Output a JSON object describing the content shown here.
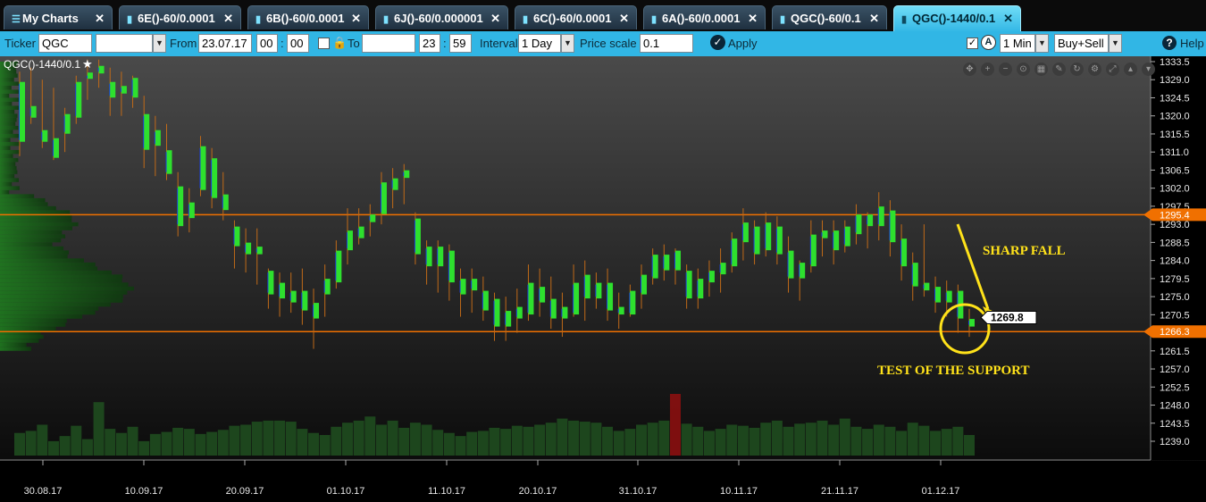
{
  "tabs": [
    {
      "label": "My Charts",
      "icon": "list-icon",
      "active": false
    },
    {
      "label": "6E()-60/0.0001",
      "icon": "bar-chart-icon",
      "active": false
    },
    {
      "label": "6B()-60/0.0001",
      "icon": "bar-chart-icon",
      "active": false
    },
    {
      "label": "6J()-60/0.000001",
      "icon": "bar-chart-icon",
      "active": false
    },
    {
      "label": "6C()-60/0.0001",
      "icon": "bar-chart-icon",
      "active": false
    },
    {
      "label": "6A()-60/0.0001",
      "icon": "bar-chart-icon",
      "active": false
    },
    {
      "label": "QGC()-60/0.1",
      "icon": "bar-chart-icon",
      "active": false
    },
    {
      "label": "QGC()-1440/0.1",
      "icon": "bar-chart-icon",
      "active": true
    }
  ],
  "toolbar": {
    "ticker_label": "Ticker",
    "ticker_value": "QGC",
    "from_label": "From",
    "from_date": "23.07.17",
    "from_hour": "00",
    "from_min": "00",
    "time_sep": ":",
    "to_label": "To",
    "to_hour": "23",
    "to_min": "59",
    "interval_label": "Interval",
    "interval_value": "1 Day",
    "price_scale_label": "Price scale",
    "price_scale_value": "0.1",
    "apply_label": "Apply",
    "timeframe_value": "1 Min",
    "side_value": "Buy+Sell",
    "help_label": "Help"
  },
  "chart": {
    "title": "QGC()-1440/0.1",
    "accent_color": "#f07000",
    "annotation_color": "#ffe21a"
  },
  "chart_data": {
    "type": "candlestick",
    "title": "QGC()-1440/0.1",
    "y_ticks": [
      "1333.5",
      "1329.0",
      "1324.5",
      "1320.0",
      "1315.5",
      "1311.0",
      "1306.5",
      "1302.0",
      "1297.5",
      "1293.0",
      "1288.5",
      "1284.0",
      "1279.5",
      "1275.0",
      "1270.5",
      "1266.0",
      "1261.5",
      "1257.0",
      "1252.5",
      "1248.0",
      "1243.5",
      "1239.0"
    ],
    "ylim": [
      1235.0,
      1335.0
    ],
    "x_ticks": [
      "30.08.17",
      "10.09.17",
      "20.09.17",
      "01.10.17",
      "11.10.17",
      "20.10.17",
      "31.10.17",
      "10.11.17",
      "21.11.17",
      "01.12.17"
    ],
    "horizontal_levels": [
      {
        "value": 1295.4,
        "label": "1295.4",
        "color": "#f07000"
      },
      {
        "value": 1266.3,
        "label": "1266.3",
        "color": "#f07000"
      }
    ],
    "last_price": {
      "value": 1269.8,
      "label": "1269.8"
    },
    "annotations": [
      {
        "text": "SHARP FALL",
        "color": "#ffe21a"
      },
      {
        "text": "TEST OF THE SUPPORT",
        "color": "#ffe21a"
      }
    ],
    "bars": [
      {
        "high": 1331,
        "low": 1310,
        "open": 1328,
        "close": 1314
      },
      {
        "high": 1332,
        "low": 1318,
        "open": 1320,
        "close": 1322
      },
      {
        "high": 1329,
        "low": 1312,
        "open": 1316,
        "close": 1314
      },
      {
        "high": 1327,
        "low": 1309,
        "open": 1310,
        "close": 1314
      },
      {
        "high": 1322,
        "low": 1311,
        "open": 1320,
        "close": 1316
      },
      {
        "high": 1330,
        "low": 1318,
        "open": 1320,
        "close": 1328
      },
      {
        "high": 1334,
        "low": 1324,
        "open": 1330,
        "close": 1330
      },
      {
        "high": 1334,
        "low": 1327,
        "open": 1332,
        "close": 1331
      },
      {
        "high": 1332,
        "low": 1320,
        "open": 1328,
        "close": 1325
      },
      {
        "high": 1331,
        "low": 1320,
        "open": 1326,
        "close": 1327
      },
      {
        "high": 1330,
        "low": 1322,
        "open": 1329,
        "close": 1325
      },
      {
        "high": 1325,
        "low": 1307,
        "open": 1320,
        "close": 1312
      },
      {
        "high": 1320,
        "low": 1305,
        "open": 1316,
        "close": 1313
      },
      {
        "high": 1318,
        "low": 1304,
        "open": 1311,
        "close": 1306
      },
      {
        "high": 1306,
        "low": 1290,
        "open": 1302,
        "close": 1293
      },
      {
        "high": 1302,
        "low": 1291,
        "open": 1298,
        "close": 1295
      },
      {
        "high": 1315,
        "low": 1300,
        "open": 1302,
        "close": 1312
      },
      {
        "high": 1312,
        "low": 1297,
        "open": 1309,
        "close": 1300
      },
      {
        "high": 1306,
        "low": 1294,
        "open": 1300,
        "close": 1297
      },
      {
        "high": 1294,
        "low": 1282,
        "open": 1292,
        "close": 1288
      },
      {
        "high": 1292,
        "low": 1281,
        "open": 1288,
        "close": 1286
      },
      {
        "high": 1292,
        "low": 1278,
        "open": 1286,
        "close": 1287
      },
      {
        "high": 1282,
        "low": 1272,
        "open": 1281,
        "close": 1276
      },
      {
        "high": 1281,
        "low": 1270,
        "open": 1278,
        "close": 1275
      },
      {
        "high": 1281,
        "low": 1271,
        "open": 1276,
        "close": 1274
      },
      {
        "high": 1282,
        "low": 1268,
        "open": 1276,
        "close": 1272
      },
      {
        "high": 1277,
        "low": 1262,
        "open": 1273,
        "close": 1270
      },
      {
        "high": 1283,
        "low": 1270,
        "open": 1276,
        "close": 1279
      },
      {
        "high": 1289,
        "low": 1277,
        "open": 1279,
        "close": 1286
      },
      {
        "high": 1297,
        "low": 1283,
        "open": 1287,
        "close": 1291
      },
      {
        "high": 1297,
        "low": 1288,
        "open": 1290,
        "close": 1292
      },
      {
        "high": 1298,
        "low": 1290,
        "open": 1294,
        "close": 1295
      },
      {
        "high": 1306,
        "low": 1293,
        "open": 1296,
        "close": 1303
      },
      {
        "high": 1307,
        "low": 1297,
        "open": 1302,
        "close": 1304
      },
      {
        "high": 1308,
        "low": 1298,
        "open": 1305,
        "close": 1306
      },
      {
        "high": 1296,
        "low": 1283,
        "open": 1294,
        "close": 1286
      },
      {
        "high": 1289,
        "low": 1278,
        "open": 1287,
        "close": 1283
      },
      {
        "high": 1289,
        "low": 1276,
        "open": 1283,
        "close": 1287
      },
      {
        "high": 1288,
        "low": 1274,
        "open": 1286,
        "close": 1279
      },
      {
        "high": 1282,
        "low": 1270,
        "open": 1279,
        "close": 1276
      },
      {
        "high": 1282,
        "low": 1271,
        "open": 1277,
        "close": 1279
      },
      {
        "high": 1280,
        "low": 1269,
        "open": 1276,
        "close": 1272
      },
      {
        "high": 1276,
        "low": 1264,
        "open": 1274,
        "close": 1268
      },
      {
        "high": 1275,
        "low": 1264,
        "open": 1268,
        "close": 1271
      },
      {
        "high": 1277,
        "low": 1266,
        "open": 1270,
        "close": 1272
      },
      {
        "high": 1283,
        "low": 1269,
        "open": 1271,
        "close": 1278
      },
      {
        "high": 1282,
        "low": 1270,
        "open": 1277,
        "close": 1274
      },
      {
        "high": 1280,
        "low": 1267,
        "open": 1274,
        "close": 1270
      },
      {
        "high": 1276,
        "low": 1265,
        "open": 1270,
        "close": 1272
      },
      {
        "high": 1283,
        "low": 1270,
        "open": 1271,
        "close": 1278
      },
      {
        "high": 1284,
        "low": 1269,
        "open": 1280,
        "close": 1275
      },
      {
        "high": 1281,
        "low": 1272,
        "open": 1275,
        "close": 1278
      },
      {
        "high": 1282,
        "low": 1269,
        "open": 1278,
        "close": 1272
      },
      {
        "high": 1276,
        "low": 1267,
        "open": 1272,
        "close": 1271
      },
      {
        "high": 1278,
        "low": 1270,
        "open": 1271,
        "close": 1276
      },
      {
        "high": 1283,
        "low": 1272,
        "open": 1276,
        "close": 1280
      },
      {
        "high": 1287,
        "low": 1278,
        "open": 1280,
        "close": 1285
      },
      {
        "high": 1288,
        "low": 1279,
        "open": 1285,
        "close": 1282
      },
      {
        "high": 1287,
        "low": 1278,
        "open": 1282,
        "close": 1286
      },
      {
        "high": 1283,
        "low": 1272,
        "open": 1281,
        "close": 1275
      },
      {
        "high": 1282,
        "low": 1272,
        "open": 1275,
        "close": 1279
      },
      {
        "high": 1284,
        "low": 1275,
        "open": 1279,
        "close": 1281
      },
      {
        "high": 1287,
        "low": 1276,
        "open": 1281,
        "close": 1283
      },
      {
        "high": 1291,
        "low": 1281,
        "open": 1283,
        "close": 1289
      },
      {
        "high": 1297,
        "low": 1284,
        "open": 1289,
        "close": 1293
      },
      {
        "high": 1294,
        "low": 1283,
        "open": 1292,
        "close": 1286
      },
      {
        "high": 1296,
        "low": 1285,
        "open": 1287,
        "close": 1293
      },
      {
        "high": 1295,
        "low": 1283,
        "open": 1292,
        "close": 1286
      },
      {
        "high": 1290,
        "low": 1276,
        "open": 1286,
        "close": 1280
      },
      {
        "high": 1284,
        "low": 1274,
        "open": 1280,
        "close": 1283
      },
      {
        "high": 1294,
        "low": 1281,
        "open": 1283,
        "close": 1290
      },
      {
        "high": 1294,
        "low": 1285,
        "open": 1290,
        "close": 1291
      },
      {
        "high": 1294,
        "low": 1283,
        "open": 1291,
        "close": 1287
      },
      {
        "high": 1294,
        "low": 1286,
        "open": 1288,
        "close": 1292
      },
      {
        "high": 1298,
        "low": 1288,
        "open": 1291,
        "close": 1295
      },
      {
        "high": 1296,
        "low": 1287,
        "open": 1295,
        "close": 1293
      },
      {
        "high": 1301,
        "low": 1289,
        "open": 1293,
        "close": 1297
      },
      {
        "high": 1299,
        "low": 1285,
        "open": 1296,
        "close": 1289
      },
      {
        "high": 1293,
        "low": 1279,
        "open": 1289,
        "close": 1283
      },
      {
        "high": 1286,
        "low": 1274,
        "open": 1283,
        "close": 1278
      },
      {
        "high": 1293,
        "low": 1275,
        "open": 1278,
        "close": 1277
      },
      {
        "high": 1280,
        "low": 1271,
        "open": 1277,
        "close": 1274
      },
      {
        "high": 1279,
        "low": 1270,
        "open": 1274,
        "close": 1276
      },
      {
        "high": 1278,
        "low": 1266,
        "open": 1276,
        "close": 1270
      },
      {
        "high": 1272,
        "low": 1265,
        "open": 1268,
        "close": 1269
      }
    ],
    "volume": [
      22,
      24,
      30,
      14,
      19,
      29,
      16,
      52,
      26,
      22,
      28,
      14,
      21,
      23,
      27,
      26,
      21,
      23,
      25,
      29,
      30,
      33,
      34,
      34,
      33,
      26,
      22,
      20,
      28,
      32,
      34,
      38,
      30,
      34,
      27,
      32,
      30,
      25,
      22,
      19,
      23,
      24,
      27,
      26,
      29,
      28,
      30,
      32,
      36,
      34,
      33,
      32,
      28,
      24,
      26,
      30,
      32,
      34,
      60,
      31,
      28,
      24,
      26,
      30,
      29,
      27,
      32,
      34,
      28,
      31,
      32,
      34,
      30,
      36,
      28,
      26,
      30,
      28,
      24,
      32,
      29,
      24,
      26,
      28,
      20
    ]
  }
}
